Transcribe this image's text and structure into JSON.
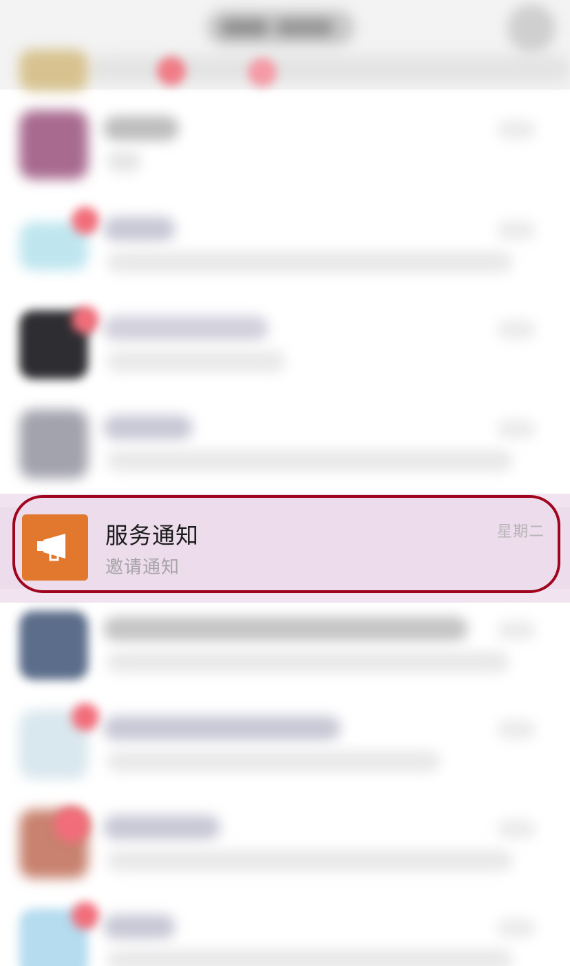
{
  "colors": {
    "highlight_border": "#a0041e",
    "highlight_background": "#ecdcec",
    "service_icon_background": "#e2782e",
    "title_text": "#1c1c1c",
    "secondary_text": "#a7a3a8"
  },
  "highlighted_chat": {
    "icon": "megaphone-icon",
    "title": "服务通知",
    "subtitle": "邀请通知",
    "time": "星期二"
  }
}
